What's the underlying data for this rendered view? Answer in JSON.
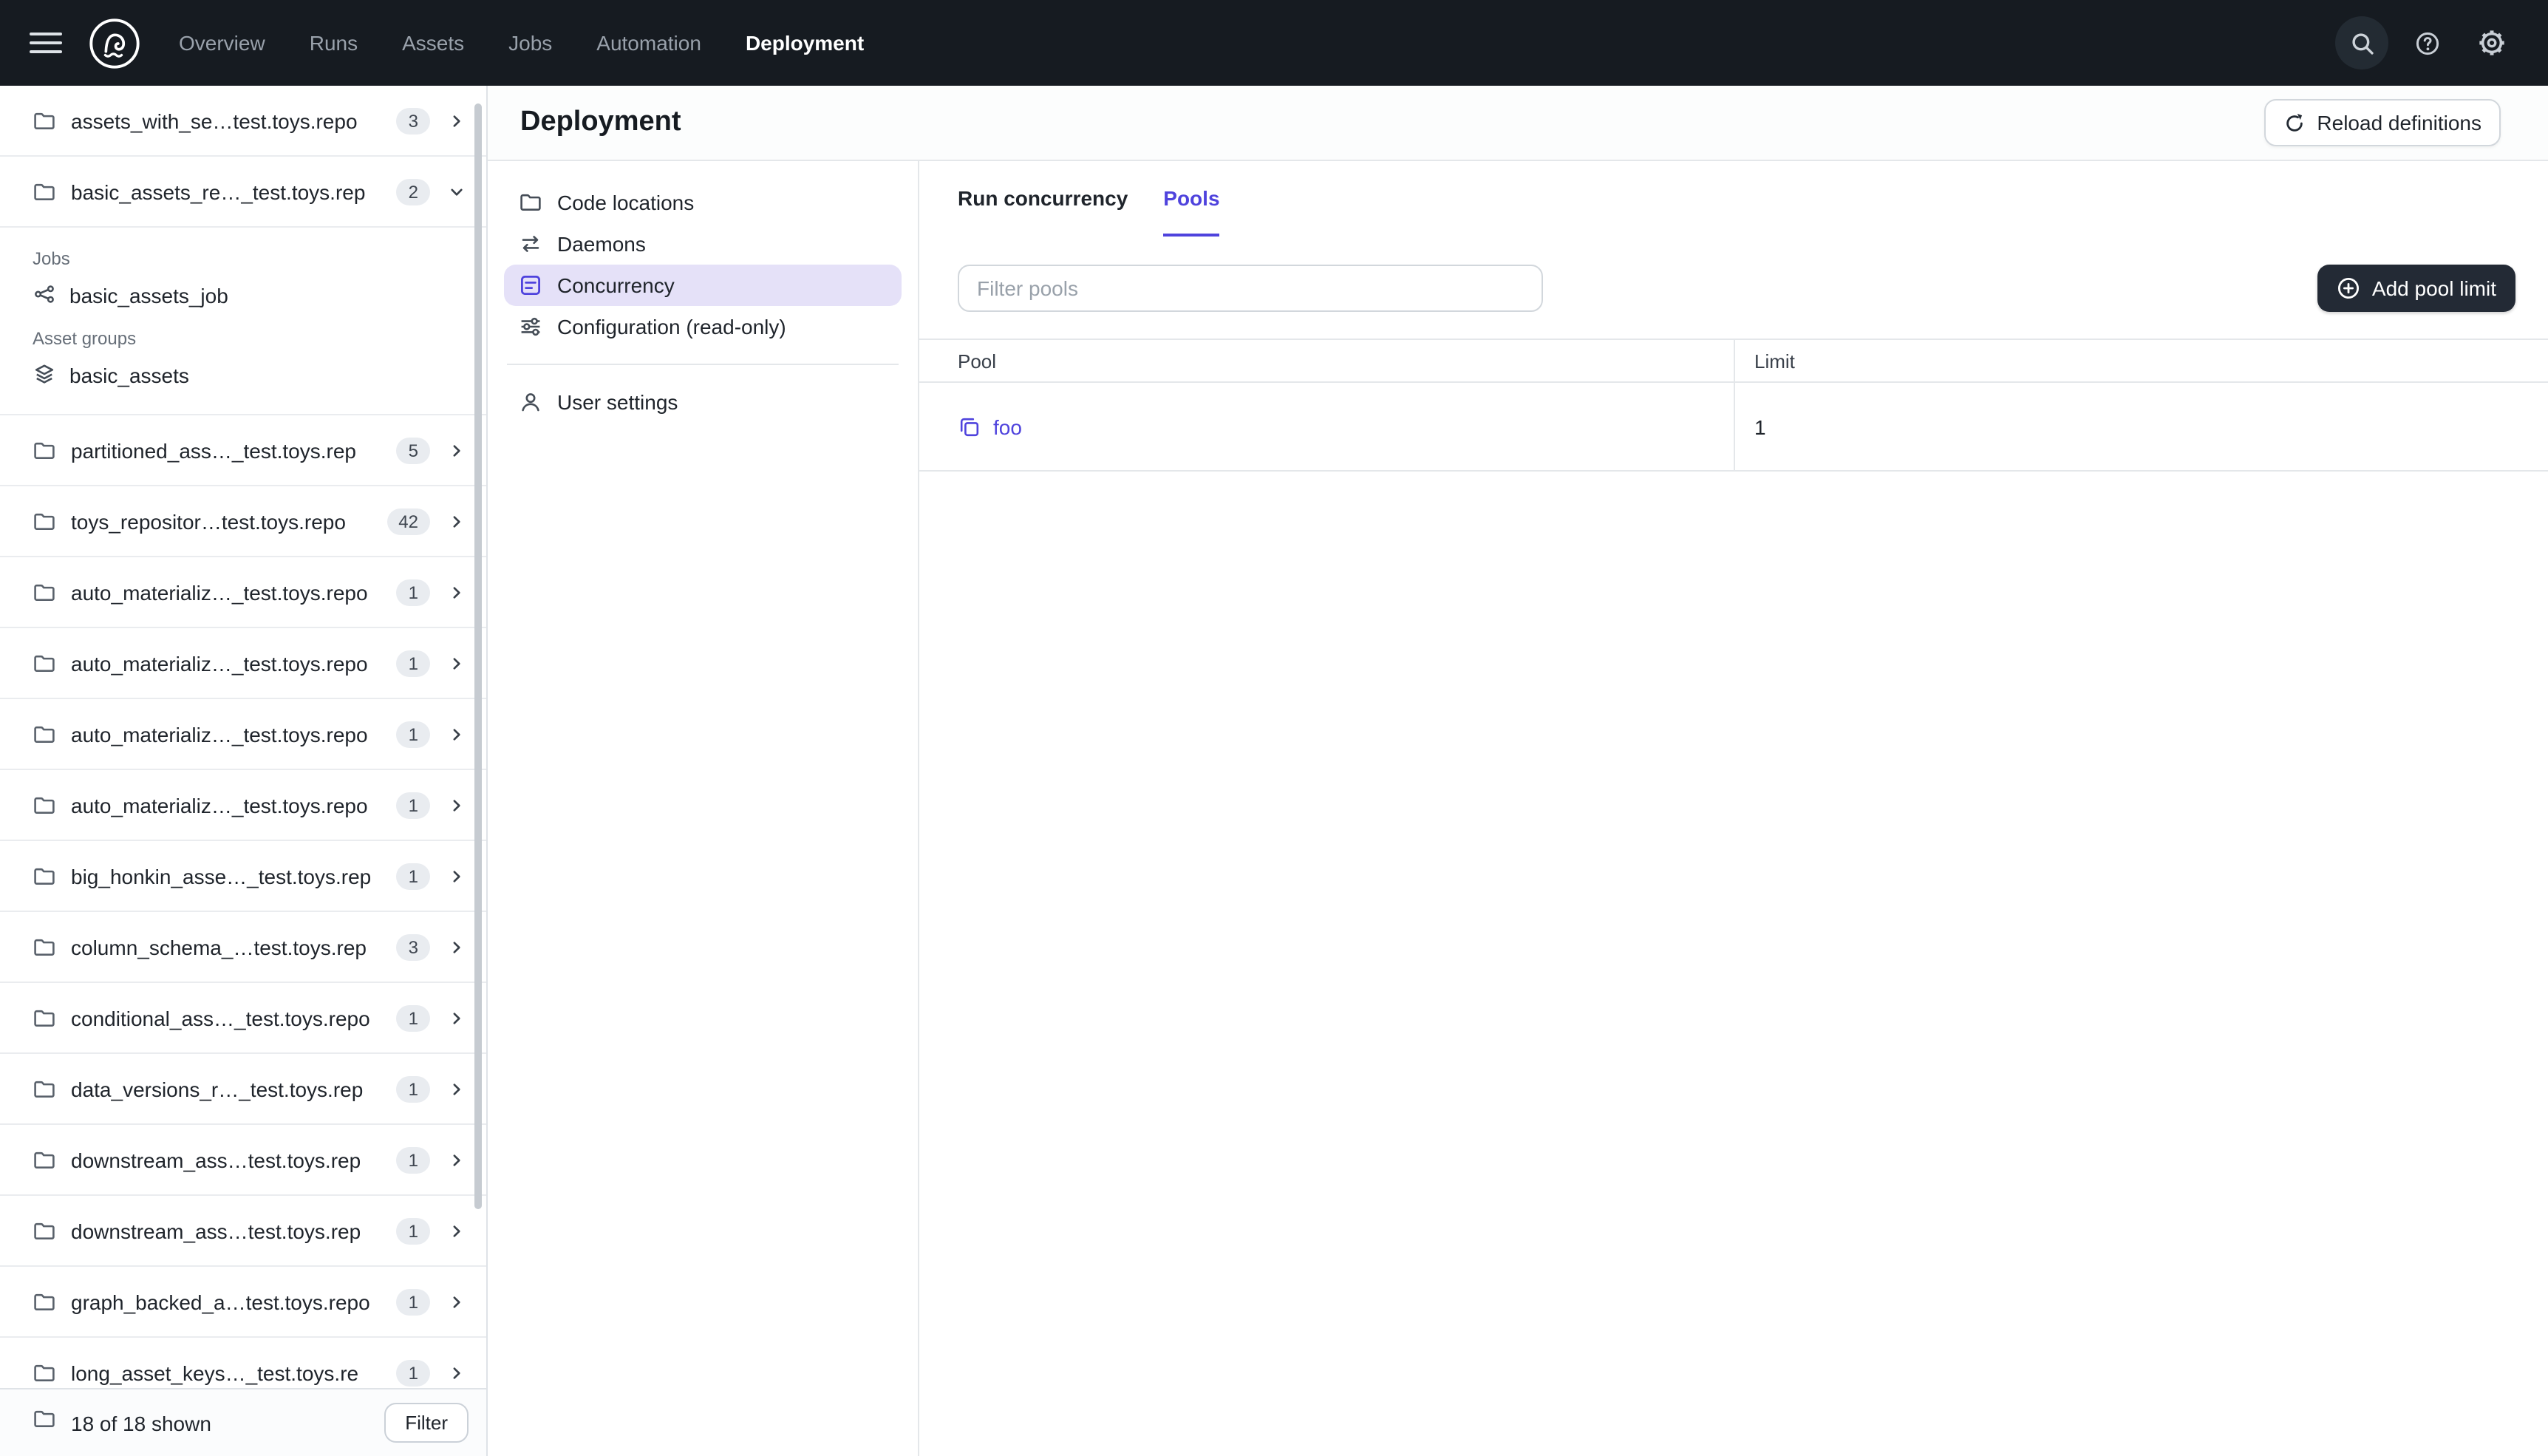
{
  "topnav": {
    "items": [
      {
        "label": "Overview",
        "active": false
      },
      {
        "label": "Runs",
        "active": false
      },
      {
        "label": "Assets",
        "active": false
      },
      {
        "label": "Jobs",
        "active": false
      },
      {
        "label": "Automation",
        "active": false
      },
      {
        "label": "Deployment",
        "active": true
      }
    ]
  },
  "sidebar": {
    "top_item": {
      "name": "assets_with_se…test.toys.repo",
      "count": "3"
    },
    "expanded_item": {
      "name": "basic_assets_re…_test.toys.rep",
      "count": "2",
      "sections": [
        {
          "label": "Jobs",
          "entries": [
            {
              "name": "basic_assets_job"
            }
          ]
        },
        {
          "label": "Asset groups",
          "entries": [
            {
              "name": "basic_assets"
            }
          ]
        }
      ]
    },
    "items": [
      {
        "name": "partitioned_ass…_test.toys.rep",
        "count": "5"
      },
      {
        "name": "toys_repositor…test.toys.repo",
        "count": "42"
      },
      {
        "name": "auto_materializ…_test.toys.repo",
        "count": "1"
      },
      {
        "name": "auto_materializ…_test.toys.repo",
        "count": "1"
      },
      {
        "name": "auto_materializ…_test.toys.repo",
        "count": "1"
      },
      {
        "name": "auto_materializ…_test.toys.repo",
        "count": "1"
      },
      {
        "name": "big_honkin_asse…_test.toys.rep",
        "count": "1"
      },
      {
        "name": "column_schema_…test.toys.rep",
        "count": "3"
      },
      {
        "name": "conditional_ass…_test.toys.repo",
        "count": "1"
      },
      {
        "name": "data_versions_r…_test.toys.rep",
        "count": "1"
      },
      {
        "name": "downstream_ass…test.toys.rep",
        "count": "1"
      },
      {
        "name": "downstream_ass…test.toys.rep",
        "count": "1"
      },
      {
        "name": "graph_backed_a…test.toys.repo",
        "count": "1"
      },
      {
        "name": "long_asset_keys…_test.toys.re",
        "count": "1"
      }
    ],
    "footer": {
      "shown": "18 of 18 shown",
      "filter_label": "Filter"
    }
  },
  "main": {
    "title": "Deployment",
    "reload_button": "Reload definitions",
    "nav": [
      {
        "label": "Code locations",
        "icon": "folder-icon",
        "active": false
      },
      {
        "label": "Daemons",
        "icon": "daemons-icon",
        "active": false
      },
      {
        "label": "Concurrency",
        "icon": "concurrency-icon",
        "active": true
      },
      {
        "label": "Configuration (read-only)",
        "icon": "config-sliders-icon",
        "active": false
      }
    ],
    "nav_secondary": [
      {
        "label": "User settings",
        "icon": "user-icon"
      }
    ],
    "tabs": [
      {
        "label": "Run concurrency",
        "active": false
      },
      {
        "label": "Pools",
        "active": true
      }
    ],
    "pools": {
      "filter_placeholder": "Filter pools",
      "add_button": "Add pool limit",
      "table": {
        "columns": [
          "Pool",
          "Limit"
        ],
        "rows": [
          {
            "pool": "foo",
            "limit": "1"
          }
        ]
      }
    }
  },
  "icons": [
    "menu-icon",
    "dagster-logo",
    "search-icon",
    "help-icon",
    "settings-gear-icon",
    "folder-icon",
    "chevron-right-icon",
    "chevron-down-icon",
    "job-icon",
    "asset-group-icon",
    "daemons-icon",
    "concurrency-icon",
    "config-sliders-icon",
    "user-icon",
    "reload-icon",
    "plus-circle-icon",
    "pool-icon"
  ],
  "colors": {
    "accent": "#4F43DD",
    "topnav_bg": "#161B21",
    "selected_nav_bg": "#E5E1F8",
    "dark_button_bg": "#232A35",
    "badge_bg": "#E9ECF0",
    "border": "#E4E7EA",
    "link": "#4F43DD"
  }
}
